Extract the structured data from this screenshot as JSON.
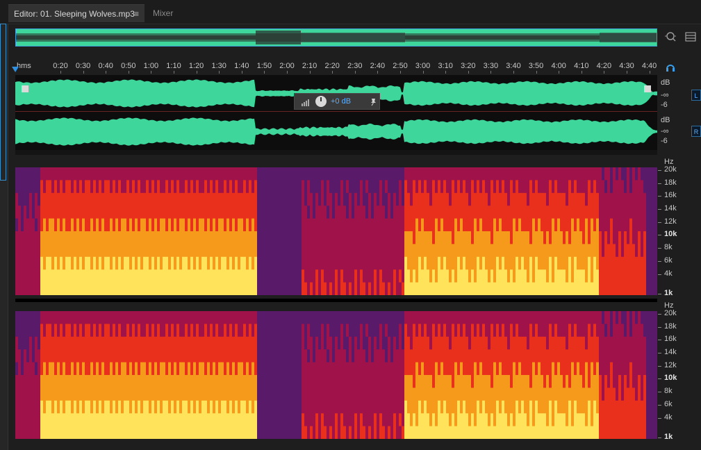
{
  "tabs": {
    "editor_label": "Editor: 01. Sleeping Wolves.mp3",
    "menu_icon": "≡",
    "mixer_label": "Mixer"
  },
  "ruler": {
    "unit": "hms",
    "labels": [
      "0:20",
      "0:30",
      "0:40",
      "0:50",
      "1:00",
      "1:10",
      "1:20",
      "1:30",
      "1:40",
      "1:50",
      "2:00",
      "2:10",
      "2:20",
      "2:30",
      "2:40",
      "2:50",
      "3:00",
      "3:10",
      "3:20",
      "3:30",
      "3:40",
      "3:50",
      "4:00",
      "4:10",
      "4:20",
      "4:30",
      "4:40"
    ]
  },
  "waveform": {
    "db_label": "dB",
    "neg_inf_label": "-∞",
    "minus6_label": "-6",
    "left_channel": "L",
    "right_channel": "R",
    "color": "#3fd69b"
  },
  "hud": {
    "value": "+0 dB"
  },
  "spectral": {
    "unit": "Hz",
    "labels": [
      "20k",
      "18k",
      "16k",
      "14k",
      "12k",
      "10k",
      "8k",
      "6k",
      "4k",
      "1k"
    ]
  },
  "icons": {
    "zoom": "zoom-icon",
    "panel": "panel-menu-icon",
    "headphones": "headphones-icon",
    "pin": "pin-icon",
    "knob": "volume-knob-icon"
  }
}
